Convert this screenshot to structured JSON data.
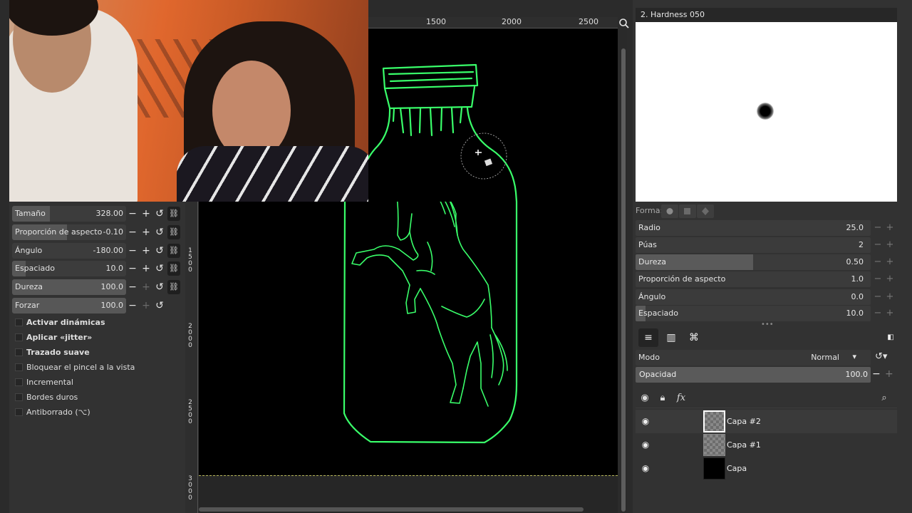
{
  "tool_options": {
    "sliders": [
      {
        "label": "Tamaño",
        "value": "328.00",
        "fill": 0.33
      },
      {
        "label": "Proporción de aspecto",
        "value": "-0.10",
        "fill": 0.48
      },
      {
        "label": "Ángulo",
        "value": "-180.00",
        "fill": 0.0
      },
      {
        "label": "Espaciado",
        "value": "10.0",
        "fill": 0.12
      },
      {
        "label": "Dureza",
        "value": "100.0",
        "fill": 1.0
      },
      {
        "label": "Forzar",
        "value": "100.0",
        "fill": 1.0
      }
    ],
    "checkboxes": [
      {
        "label": "Activar dinámicas",
        "bold": true
      },
      {
        "label": "Aplicar «jitter»",
        "bold": true
      },
      {
        "label": "Trazado suave",
        "bold": true
      },
      {
        "label": "Bloquear el pincel a la vista",
        "bold": false
      },
      {
        "label": "Incremental",
        "bold": false
      },
      {
        "label": "Bordes duros",
        "bold": false
      },
      {
        "label": "Antiborrado  (⌥)",
        "bold": false
      }
    ]
  },
  "ruler": {
    "top_labels": [
      "1500",
      "2000",
      "2500"
    ],
    "left_labels": [
      "1\n5\n0\n0",
      "2\n0\n0\n0",
      "2\n5\n0\n0",
      "3\n0\n0\n0"
    ]
  },
  "brush_panel": {
    "title": "2. Hardness 050",
    "shape_label": "Forma:",
    "params": [
      {
        "label": "Radio",
        "value": "25.0",
        "fill": 0.0
      },
      {
        "label": "Púas",
        "value": "2",
        "fill": 0.0
      },
      {
        "label": "Dureza",
        "value": "0.50",
        "fill": 0.5
      },
      {
        "label": "Proporción de aspecto",
        "value": "1.0",
        "fill": 0.0
      },
      {
        "label": "Ángulo",
        "value": "0.0",
        "fill": 0.0
      },
      {
        "label": "Espaciado",
        "value": "10.0",
        "fill": 0.04
      }
    ]
  },
  "layers_panel": {
    "mode_label": "Modo",
    "mode_value": "Normal",
    "opacity_label": "Opacidad",
    "opacity_value": "100.0",
    "layers": [
      {
        "name": "Capa #2",
        "selected": true
      },
      {
        "name": "Capa #1",
        "selected": false
      },
      {
        "name": "Capa",
        "selected": false
      }
    ]
  },
  "colors": {
    "stroke": "#39ff6a",
    "panel_bg": "#323232",
    "canvas_bg": "#000000"
  }
}
